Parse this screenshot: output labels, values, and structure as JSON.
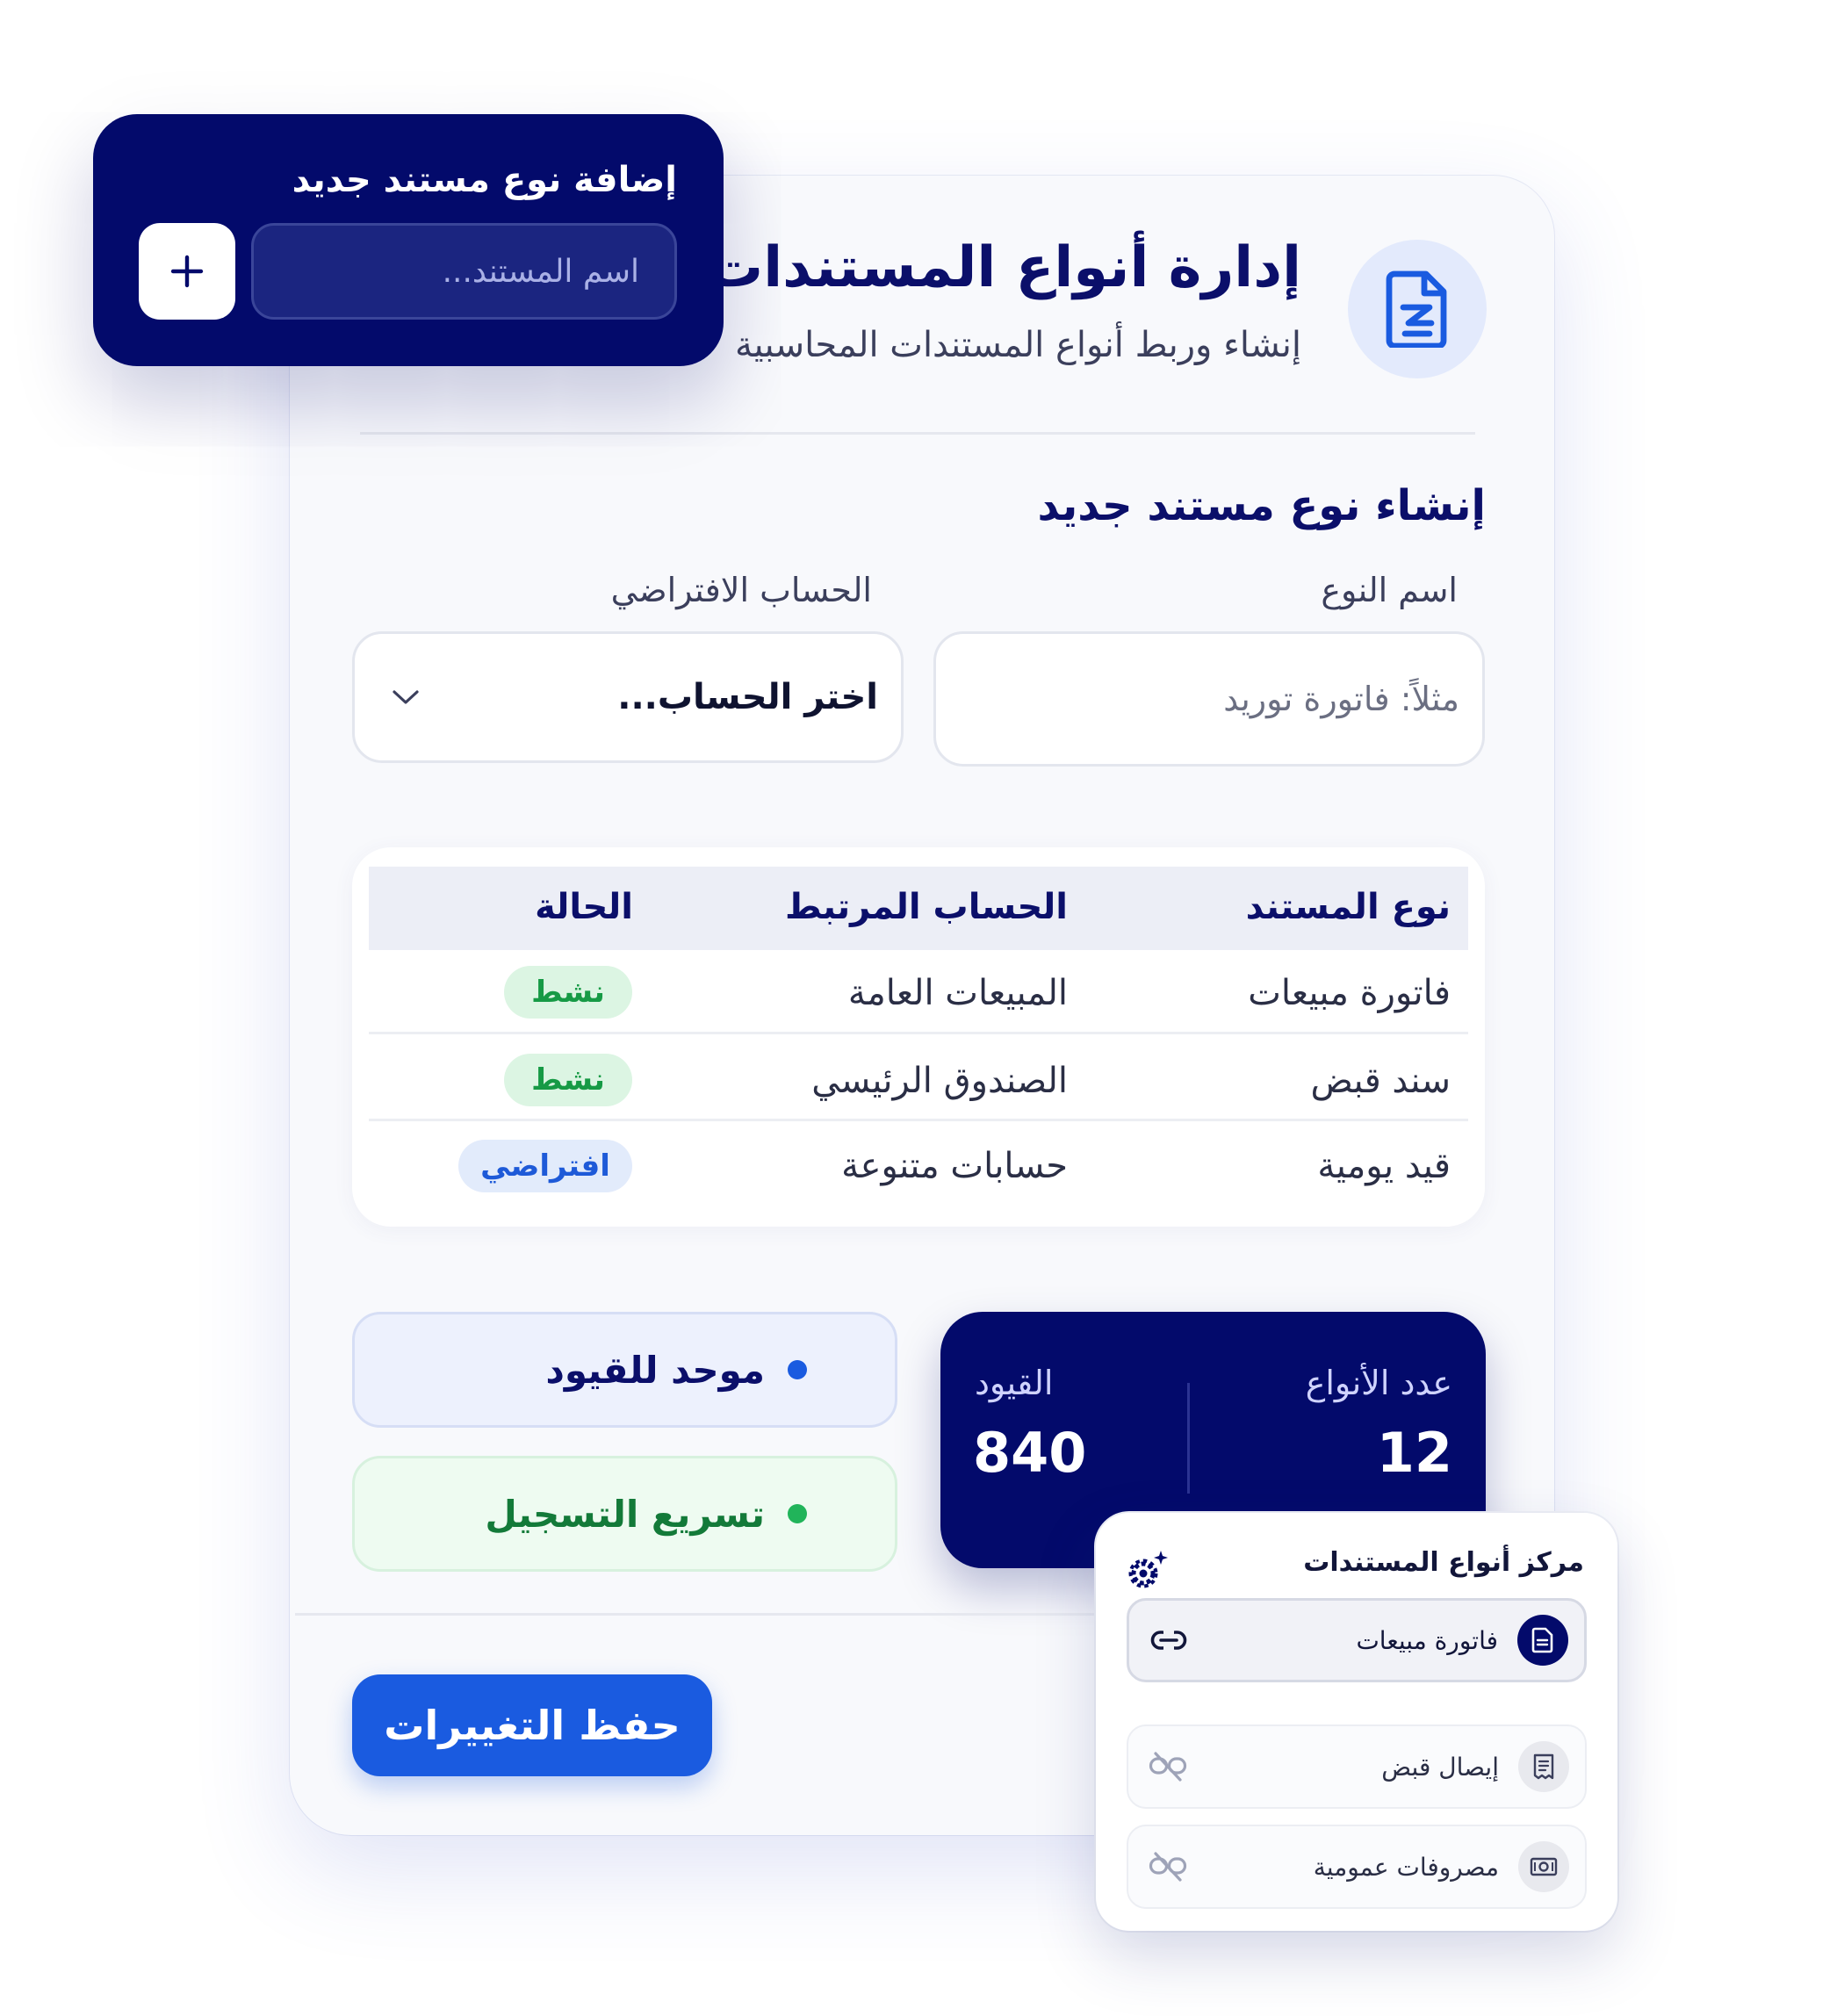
{
  "header": {
    "title": "إدارة أنواع المستندات",
    "subtitle": "إنشاء وربط أنواع المستندات المحاسبية",
    "icon": "document-icon"
  },
  "create_section": {
    "title": "إنشاء نوع مستند جديد",
    "type_name_label": "اسم النوع",
    "type_name_placeholder": "مثلاً: فاتورة توريد",
    "default_account_label": "الحساب الافتراضي",
    "default_account_value": "اختر الحساب..."
  },
  "table": {
    "headers": [
      "نوع المستند",
      "الحساب المرتبط",
      "الحالة"
    ],
    "rows": [
      {
        "type": "فاتورة مبيعات",
        "account": "المبيعات العامة",
        "status": "نشط",
        "status_kind": "active"
      },
      {
        "type": "سند قبض",
        "account": "الصندوق الرئيسي",
        "status": "نشط",
        "status_kind": "active"
      },
      {
        "type": "قيد يومية",
        "account": "حسابات متنوعة",
        "status": "افتراضي",
        "status_kind": "default"
      }
    ]
  },
  "stats": {
    "types_label": "عدد الأنواع",
    "types_value": "12",
    "entries_label": "القيود",
    "entries_value": "840"
  },
  "features": {
    "unified": "موحد للقيود",
    "fast": "تسريع التسجيل"
  },
  "save_button": "حفظ التغييرات",
  "add_card": {
    "title": "إضافة نوع مستند جديد",
    "placeholder": "اسم المستند..."
  },
  "doc_center": {
    "title": "مركز أنواع المستندات",
    "items": [
      {
        "name": "فاتورة مبيعات",
        "icon": "document-icon",
        "linked": true
      },
      {
        "name": "إيصال قبض",
        "icon": "receipt-icon",
        "linked": false
      },
      {
        "name": "مصروفات عمومية",
        "icon": "money-icon",
        "linked": false
      }
    ]
  },
  "colors": {
    "navy": "#030a6b",
    "accent_blue": "#1a5be0",
    "active_green": "#169a45",
    "card_bg": "#f8f9fc"
  }
}
